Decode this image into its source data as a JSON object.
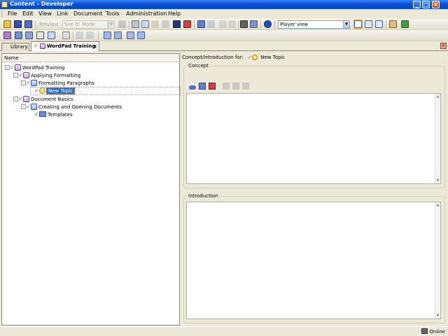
{
  "window": {
    "title": "Content - Developer",
    "minimize": "_",
    "maximize": "□",
    "close": "×"
  },
  "menu": [
    "File",
    "Edit",
    "View",
    "Link",
    "Document",
    "Tools",
    "Administration",
    "Help"
  ],
  "toolbar": {
    "preview_label": "Preview",
    "mode_combo": "See It! Mode",
    "view_combo": "Player view"
  },
  "tabs": [
    {
      "label": "Library",
      "active": false
    },
    {
      "label": "WordPad Training",
      "active": true,
      "close": "×"
    }
  ],
  "outline": {
    "column_header": "Name",
    "items": [
      {
        "label": "WordPad Training",
        "level": 0,
        "icon": "module-icon",
        "expander": "-"
      },
      {
        "label": "Applying Formatting",
        "level": 1,
        "icon": "module-icon",
        "expander": "-"
      },
      {
        "label": "Formatting Paragraphs",
        "level": 2,
        "icon": "section-icon",
        "expander": "-"
      },
      {
        "label": "New Topic",
        "level": 3,
        "icon": "topic-icon",
        "selected": true
      },
      {
        "label": "Document Basics",
        "level": 1,
        "icon": "module-icon",
        "expander": "-"
      },
      {
        "label": "Creating and Opening Documents",
        "level": 2,
        "icon": "section-icon",
        "expander": "-"
      },
      {
        "label": "Templates",
        "level": 3,
        "icon": "document-icon"
      }
    ]
  },
  "details": {
    "header_prefix": "Concept/Introduction for:",
    "header_item": "New Topic",
    "concept_title": "Concept",
    "introduction_title": "Introduction"
  },
  "status": {
    "text": "Online"
  },
  "colors": {
    "selection": "#316ac5",
    "check": "#1a9a1a",
    "titlebar": "#0a56d8"
  }
}
